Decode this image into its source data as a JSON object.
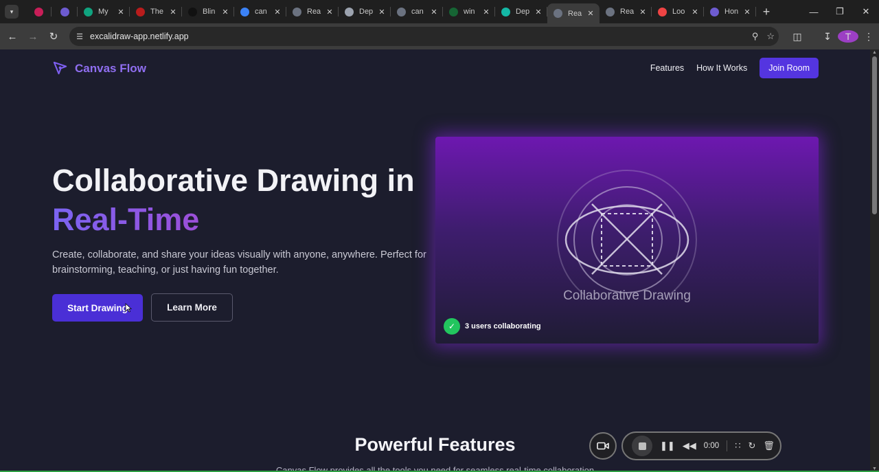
{
  "browser": {
    "tabs": [
      {
        "title": "",
        "favicon": "#c81e58",
        "pinned": true
      },
      {
        "title": "",
        "favicon": "#6d5bd0",
        "pinned": true
      },
      {
        "title": "My",
        "favicon": "#10a37f"
      },
      {
        "title": "The",
        "favicon": "#b91c1c"
      },
      {
        "title": "Blin",
        "favicon": "#111111"
      },
      {
        "title": "can",
        "favicon": "#3b82f6"
      },
      {
        "title": "Rea",
        "favicon": "#6b7280"
      },
      {
        "title": "Dep",
        "favicon": "#9ca3af"
      },
      {
        "title": "can",
        "favicon": "#6b7280"
      },
      {
        "title": "win",
        "favicon": "#166534"
      },
      {
        "title": "Dep",
        "favicon": "#14b8a6"
      },
      {
        "title": "Rea",
        "favicon": "#6b7280",
        "active": true
      },
      {
        "title": "Rea",
        "favicon": "#6b7280"
      },
      {
        "title": "Loo",
        "favicon": "#ef4444"
      },
      {
        "title": "Hon",
        "favicon": "#6d5bd0"
      }
    ],
    "url": "excalidraw-app.netlify.app",
    "profile_initial": "T"
  },
  "site": {
    "brand": "Canvas Flow",
    "nav": {
      "features": "Features",
      "how": "How It Works",
      "join": "Join Room"
    },
    "hero": {
      "title_line1": "Collaborative Drawing in",
      "title_line2": "Real-Time",
      "lead": "Create, collaborate, and share your ideas visually with anyone, anywhere. Perfect for brainstorming, teaching, or just having fun together.",
      "primary_button": "Start Drawing",
      "secondary_button": "Learn More"
    },
    "preview": {
      "caption": "Collaborative Drawing",
      "collab_status": "3 users collaborating"
    },
    "features": {
      "title": "Powerful Features",
      "subtitle": "Canvas Flow provides all the tools you need for seamless real-time collaboration"
    }
  },
  "recorder": {
    "time": "0:00"
  },
  "colors": {
    "accent": "#5435e0",
    "brand": "#8f6ef0",
    "success": "#22c55e",
    "card_top": "#6d18b0"
  }
}
